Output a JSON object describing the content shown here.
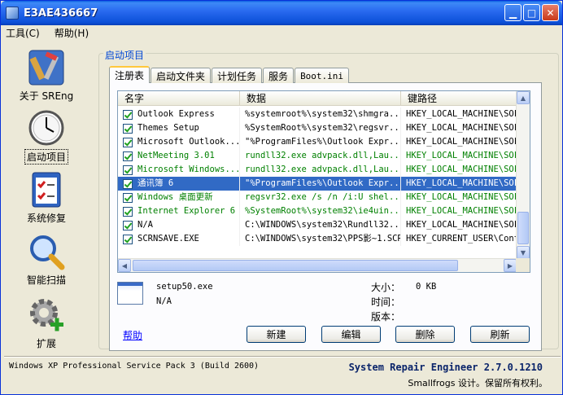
{
  "window": {
    "title": "E3AE436667"
  },
  "menu": {
    "tools": "工具(C)",
    "help": "帮助(H)"
  },
  "sidebar": [
    {
      "label": "关于 SREng",
      "icon": "tools-icon"
    },
    {
      "label": "启动项目",
      "icon": "clock-icon"
    },
    {
      "label": "系统修复",
      "icon": "checklist-icon"
    },
    {
      "label": "智能扫描",
      "icon": "magnifier-icon"
    },
    {
      "label": "扩展",
      "icon": "gear-plus-icon"
    }
  ],
  "group_title": "启动项目",
  "tabs": [
    "注册表",
    "启动文件夹",
    "计划任务",
    "服务",
    "Boot.ini"
  ],
  "list": {
    "columns": [
      "名字",
      "数据",
      "键路径"
    ],
    "rows": [
      {
        "name": "Outlook Express",
        "data": "%systemroot%\\system32\\shmgra...",
        "path": "HKEY_LOCAL_MACHINE\\SOF",
        "style": "normal"
      },
      {
        "name": "Themes Setup",
        "data": "%SystemRoot%\\system32\\regsvr...",
        "path": "HKEY_LOCAL_MACHINE\\SOF",
        "style": "normal"
      },
      {
        "name": "Microsoft Outlook...",
        "data": "\"%ProgramFiles%\\Outlook Expr...",
        "path": "HKEY_LOCAL_MACHINE\\SOF",
        "style": "normal"
      },
      {
        "name": "NetMeeting 3.01",
        "data": "rundll32.exe advpack.dll,Lau...",
        "path": "HKEY_LOCAL_MACHINE\\SOF",
        "style": "green"
      },
      {
        "name": "Microsoft Windows...",
        "data": "rundll32.exe advpack.dll,Lau...",
        "path": "HKEY_LOCAL_MACHINE\\SOF",
        "style": "green"
      },
      {
        "name": "通讯簿 6",
        "data": "\"%ProgramFiles%\\Outlook Expr...",
        "path": "HKEY_LOCAL_MACHINE\\SOF",
        "style": "selected"
      },
      {
        "name": "Windows 桌面更新",
        "data": "regsvr32.exe /s /n /i:U shel...",
        "path": "HKEY_LOCAL_MACHINE\\SOF",
        "style": "green"
      },
      {
        "name": "Internet Explorer 6",
        "data": "%SystemRoot%\\system32\\ie4uin...",
        "path": "HKEY_LOCAL_MACHINE\\SOF",
        "style": "green"
      },
      {
        "name": "N/A",
        "data": "C:\\WINDOWS\\system32\\Rundll32...",
        "path": "HKEY_LOCAL_MACHINE\\SOF",
        "style": "normal"
      },
      {
        "name": "SCRNSAVE.EXE",
        "data": "C:\\WINDOWS\\system32\\PPS影~1.SCR",
        "path": "HKEY_CURRENT_USER\\Cont",
        "style": "normal"
      }
    ]
  },
  "details": {
    "filename": "setup50.exe",
    "company": "N/A",
    "size_label": "大小：",
    "size_value": "0 KB",
    "time_label": "时间：",
    "version_label": "版本："
  },
  "help_link": "帮助",
  "buttons": {
    "new": "新建",
    "edit": "编辑",
    "delete": "删除",
    "refresh": "刷新"
  },
  "status": {
    "os": "Windows XP Professional Service Pack 3 (Build 2600)",
    "app": "System Repair Engineer 2.7.0.1210",
    "copyright": "Smallfrogs 设计。保留所有权利。"
  },
  "colors": {
    "title_blue": "#0a5fe0",
    "selection": "#316ac5",
    "green_text": "#008000",
    "link": "#0000ff"
  }
}
